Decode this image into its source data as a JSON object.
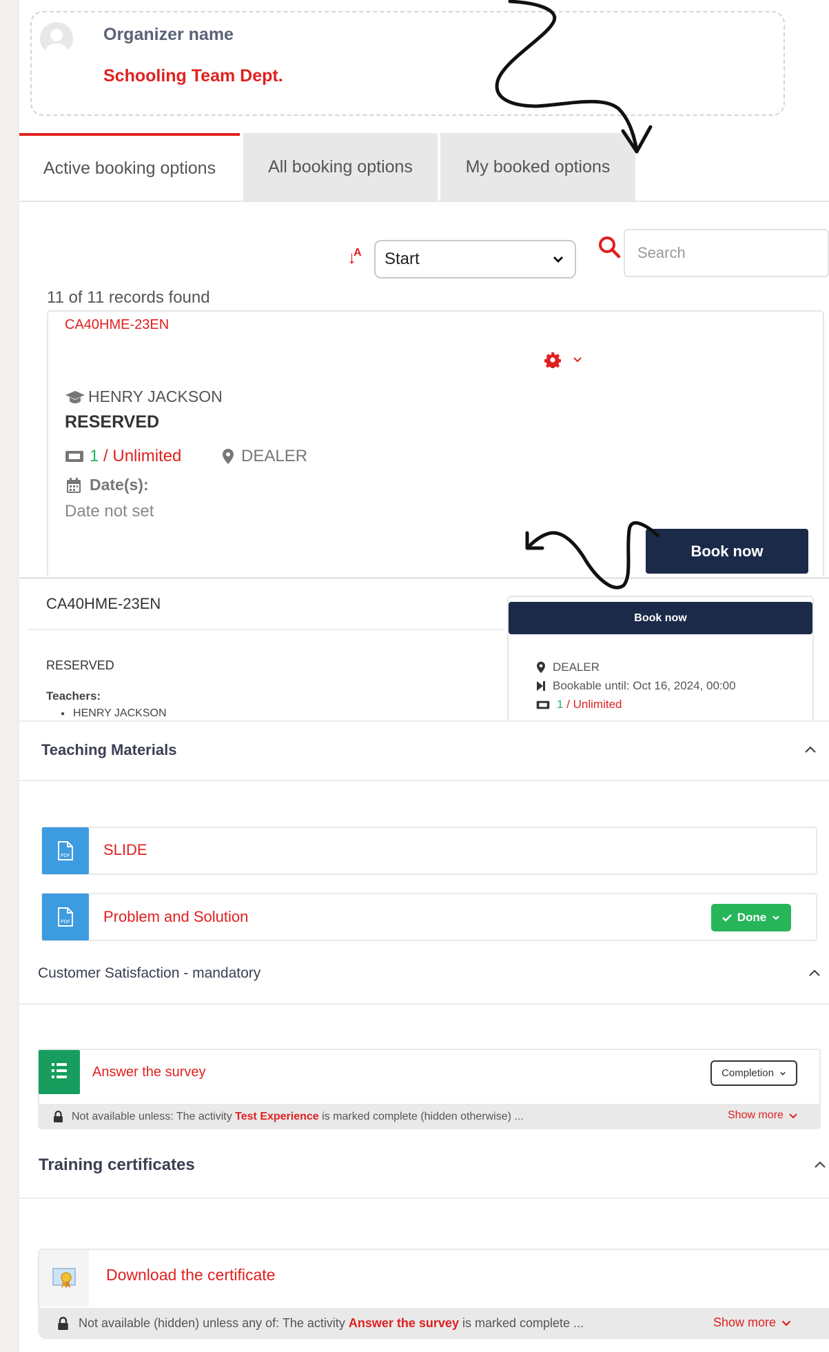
{
  "organizer": {
    "label": "Organizer name",
    "value": "Schooling Team Dept."
  },
  "tabs": [
    {
      "label": "Active booking options",
      "active": true
    },
    {
      "label": "All booking options",
      "active": false
    },
    {
      "label": "My booked options",
      "active": false
    }
  ],
  "filter": {
    "sort_selected": "Start",
    "search_placeholder": "Search"
  },
  "records_found": "11 of 11 records found",
  "card": {
    "id": "CA40HME-23EN",
    "teacher": "HENRY JACKSON",
    "status": "RESERVED",
    "places_booked": "1",
    "places_separator": " / ",
    "places_total": "Unlimited",
    "location": "DEALER",
    "dates_label": "Date(s):",
    "dates_value": "Date not set",
    "book_button": "Book now"
  },
  "detail": {
    "title": "CA40HME-23EN",
    "status": "RESERVED",
    "teachers_label": "Teachers:",
    "teachers": [
      "HENRY JACKSON"
    ],
    "book_button": "Book now",
    "location": "DEALER",
    "bookable_until": "Bookable until: Oct 16, 2024, 00:00",
    "places_booked": "1",
    "places_rest": " / Unlimited"
  },
  "sections": {
    "materials": {
      "title": "Teaching Materials",
      "items": [
        {
          "label": "SLIDE",
          "icon": "pdf-icon"
        },
        {
          "label": "Problem and Solution",
          "icon": "pdf-icon",
          "badge": "Done"
        }
      ]
    },
    "satisfaction": {
      "title": "Customer Satisfaction - mandatory",
      "item": {
        "label": "Answer the survey",
        "icon": "survey-icon",
        "badge": "Completion"
      },
      "restriction_prefix": "Not available unless: The activity ",
      "restriction_link": "Test Experience",
      "restriction_suffix": " is marked complete (hidden otherwise) ...",
      "show_more": "Show more"
    },
    "certificates": {
      "title": "Training certificates",
      "item": {
        "label": "Download the certificate",
        "icon": "certificate-icon"
      },
      "restriction_prefix": "Not available (hidden) unless any of: The activity ",
      "restriction_link": "Answer the survey",
      "restriction_suffix": " is marked complete ...",
      "show_more": "Show more"
    }
  },
  "colors": {
    "accent": "#e02020",
    "navy": "#1c2a4a",
    "success": "#27b55a",
    "pdf_blue": "#3d9be0",
    "survey_green": "#179e5e"
  }
}
